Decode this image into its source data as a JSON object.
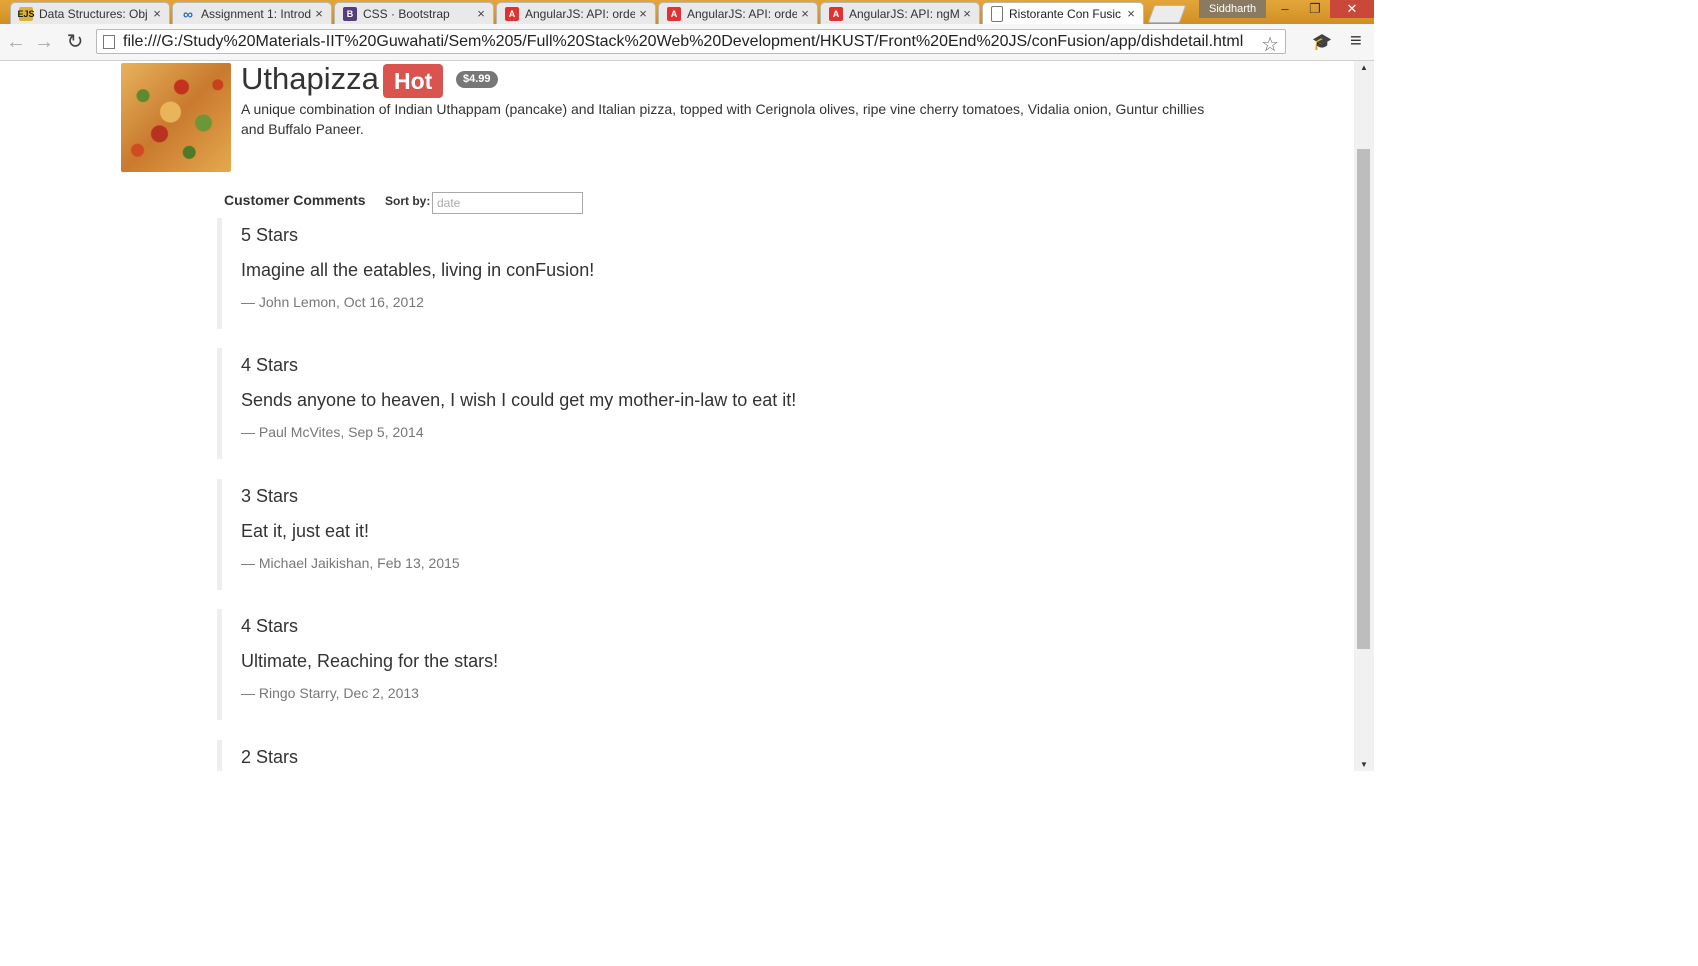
{
  "browser": {
    "tabs": [
      {
        "label": "Data Structures: Obj",
        "icon": "EJS"
      },
      {
        "label": "Assignment 1: Introd",
        "icon": "∞"
      },
      {
        "label": "CSS · Bootstrap",
        "icon": "B"
      },
      {
        "label": "AngularJS: API: orde",
        "icon": "A"
      },
      {
        "label": "AngularJS: API: orde",
        "icon": "A"
      },
      {
        "label": "AngularJS: API: ngM",
        "icon": "A"
      },
      {
        "label": "Ristorante Con Fusic",
        "icon": "page"
      }
    ],
    "profile_name": "Siddharth",
    "url": "file:///G:/Study%20Materials-IIT%20Guwahati/Sem%205/Full%20Stack%20Web%20Development/HKUST/Front%20End%20JS/conFusion/app/dishdetail.html"
  },
  "dish": {
    "name": "Uthapizza",
    "label": "Hot",
    "price": "$4.99",
    "description": "A unique combination of Indian Uthappam (pancake) and Italian pizza, topped with Cerignola olives, ripe vine cherry tomatoes, Vidalia onion, Guntur chillies and Buffalo Paneer."
  },
  "comments_section": {
    "heading": "Customer Comments",
    "sort_label": "Sort by:",
    "sort_placeholder": "date",
    "comments": [
      {
        "rating": "5 Stars",
        "text": "Imagine all the eatables, living in conFusion!",
        "footer": "— John Lemon, Oct 16, 2012"
      },
      {
        "rating": "4 Stars",
        "text": "Sends anyone to heaven, I wish I could get my mother-in-law to eat it!",
        "footer": "— Paul McVites, Sep 5, 2014"
      },
      {
        "rating": "3 Stars",
        "text": "Eat it, just eat it!",
        "footer": "— Michael Jaikishan, Feb 13, 2015"
      },
      {
        "rating": "4 Stars",
        "text": "Ultimate, Reaching for the stars!",
        "footer": "— Ringo Starry, Dec 2, 2013"
      },
      {
        "rating": "2 Stars",
        "text": "",
        "footer": ""
      }
    ]
  }
}
